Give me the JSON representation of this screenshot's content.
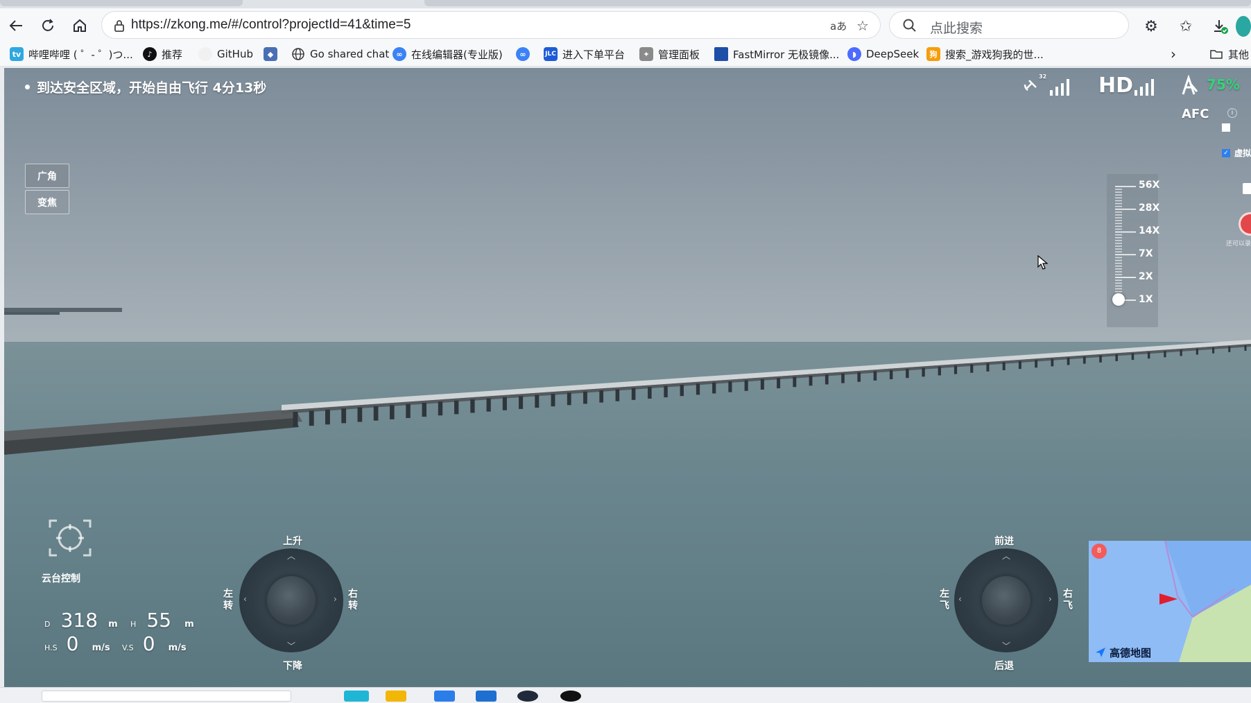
{
  "browser": {
    "url": "https://zkong.me/#/control?projectId=41&time=5",
    "search_placeholder": "点此搜索",
    "translate_icon": "aあ"
  },
  "bookmarks": [
    {
      "label": "哔哩哔哩 ( ゜- ゜)つ...",
      "icon": "bilibili-icon",
      "color": "#2fa8e1"
    },
    {
      "label": "推荐",
      "icon": "tiktok-icon",
      "color": "#111111"
    },
    {
      "label": "GitHub",
      "icon": "github-icon",
      "color": "#f1f1f1"
    },
    {
      "label": "",
      "icon": "shield-icon",
      "color": "#4a6fb5"
    },
    {
      "label": "Go shared chat",
      "icon": "globe-icon",
      "color": "#ffffff"
    },
    {
      "label": "在线编辑器(专业版)",
      "icon": "editor-icon",
      "color": "#3b82f6"
    },
    {
      "label": "",
      "icon": "cloud-icon",
      "color": "#3b82f6"
    },
    {
      "label": "进入下单平台",
      "icon": "jlc-icon",
      "color": "#1f5bd8"
    },
    {
      "label": "管理面板",
      "icon": "panel-icon",
      "color": "#8a8a8a"
    },
    {
      "label": "FastMirror 无极镜像...",
      "icon": "fastmirror-icon",
      "color": "#1e4fa8"
    },
    {
      "label": "DeepSeek",
      "icon": "deepseek-icon",
      "color": "#4d6bfe"
    },
    {
      "label": "搜索_游戏狗我的世...",
      "icon": "gamedog-icon",
      "color": "#f59e0b"
    },
    {
      "label": "其他",
      "icon": "folder-icon",
      "color": "#ffffff"
    }
  ],
  "hud": {
    "status": "到达安全区域，开始自由飞行 4分13秒",
    "satellite_count": "32",
    "hd_label": "HD",
    "battery": "75%",
    "afc_label": "AFC",
    "lens_wide": "广角",
    "lens_zoom": "变焦",
    "zoom_levels": [
      "56X",
      "28X",
      "14X",
      "7X",
      "2X",
      "1X"
    ],
    "zoom_selected": "1X",
    "right_check_label": "虚拟",
    "record_hint": "还可以录"
  },
  "gimbal": {
    "label": "云台控制"
  },
  "telemetry": {
    "d_label": "D",
    "d_value": "318",
    "d_unit": "m",
    "h_label": "H",
    "h_value": "55",
    "h_unit": "m",
    "hs_label": "H.S",
    "hs_value": "0",
    "hs_unit": "m/s",
    "vs_label": "V.S",
    "vs_value": "0",
    "vs_unit": "m/s"
  },
  "left_stick": {
    "up": "上升",
    "down": "下降",
    "left": "左转",
    "right": "右转"
  },
  "right_stick": {
    "up": "前进",
    "down": "后退",
    "left": "左飞",
    "right": "右飞"
  },
  "map": {
    "provider": "高德地图",
    "marker_badge": "8"
  },
  "colors": {
    "battery": "#34d27a",
    "map_water": "#8fbcf5",
    "map_land": "#c9e3b0",
    "heading_arrow": "#e11d2e"
  }
}
